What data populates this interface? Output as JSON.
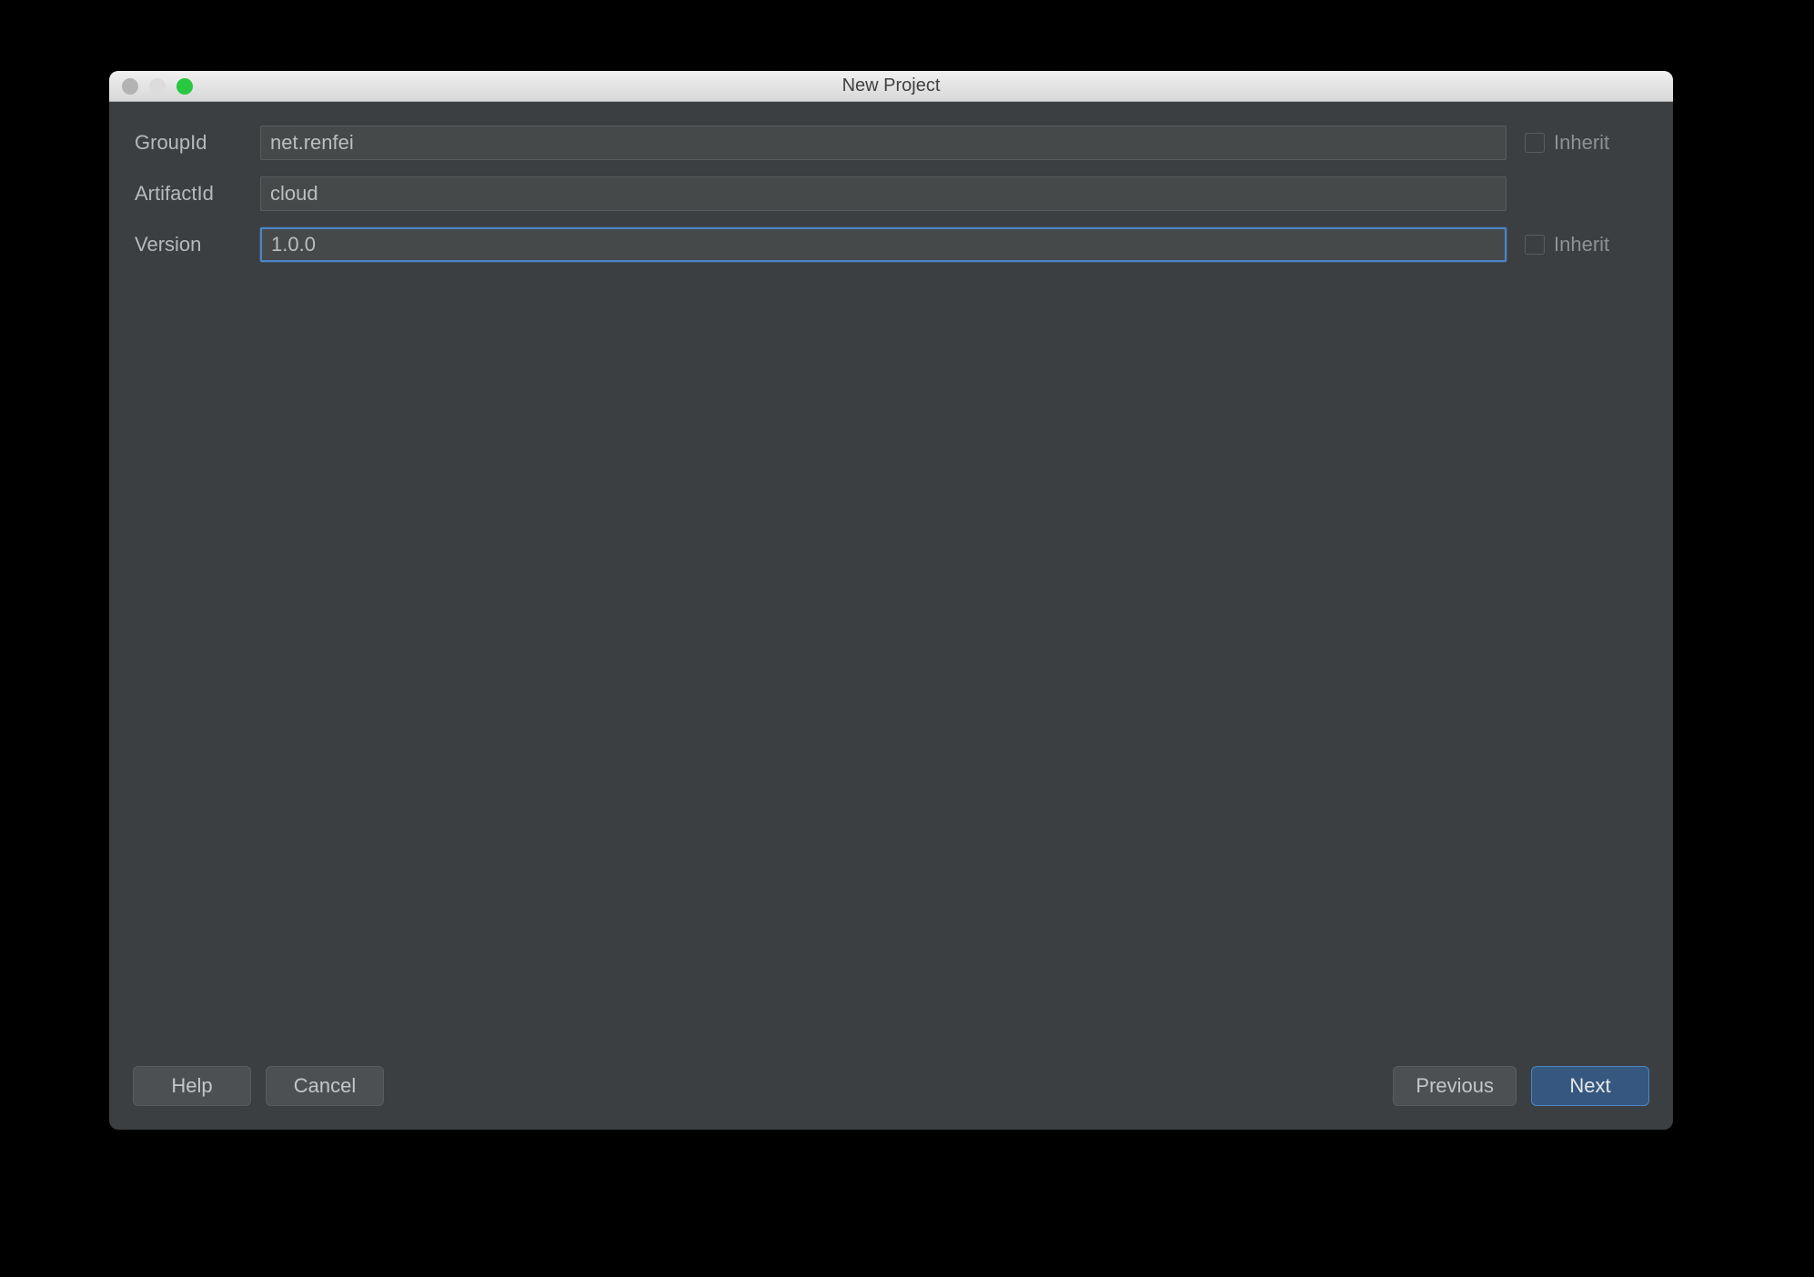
{
  "window": {
    "title": "New Project"
  },
  "form": {
    "groupid": {
      "label": "GroupId",
      "value": "net.renfei",
      "inherit_label": "Inherit",
      "inherit_checked": false
    },
    "artifactid": {
      "label": "ArtifactId",
      "value": "cloud"
    },
    "version": {
      "label": "Version",
      "value": "1.0.0",
      "inherit_label": "Inherit",
      "inherit_checked": false,
      "focused": true
    }
  },
  "buttons": {
    "help": "Help",
    "cancel": "Cancel",
    "previous": "Previous",
    "next": "Next"
  }
}
